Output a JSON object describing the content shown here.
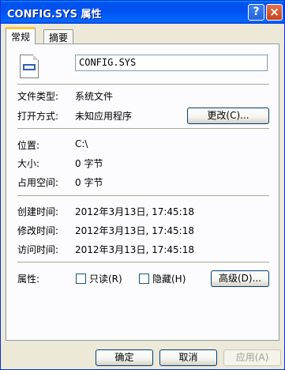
{
  "window": {
    "title": "CONFIG.SYS 属性",
    "help_glyph": "?",
    "close_glyph": "×"
  },
  "tabs": [
    {
      "label": "常规"
    },
    {
      "label": "摘要"
    }
  ],
  "file": {
    "name": "CONFIG.SYS",
    "icon": "system-file-icon"
  },
  "details": {
    "type_label": "文件类型:",
    "type_value": "系统文件",
    "opens_label": "打开方式:",
    "opens_value": "未知应用程序",
    "change_button": "更改(C)...",
    "location_label": "位置:",
    "location_value": "C:\\",
    "size_label": "大小:",
    "size_value": "0 字节",
    "disk_label": "占用空间:",
    "disk_value": "0 字节",
    "created_label": "创建时间:",
    "created_value": "2012年3月13日, 17:45:18",
    "modified_label": "修改时间:",
    "modified_value": "2012年3月13日, 17:45:18",
    "accessed_label": "访问时间:",
    "accessed_value": "2012年3月13日, 17:45:18"
  },
  "attributes": {
    "label": "属性:",
    "readonly": "只读(R)",
    "readonly_checked": false,
    "hidden": "隐藏(H)",
    "hidden_checked": false,
    "advanced_button": "高级(D)..."
  },
  "footer": {
    "ok": "确定",
    "cancel": "取消",
    "apply": "应用(A)"
  }
}
